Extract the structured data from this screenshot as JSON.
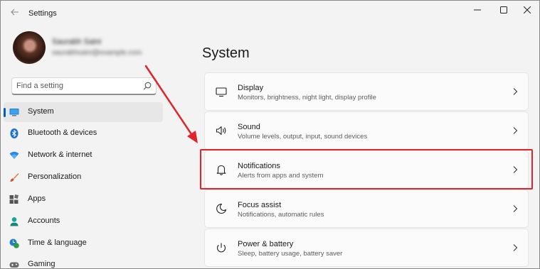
{
  "window": {
    "title": "Settings"
  },
  "user": {
    "name": "Saurabh Saini",
    "email": "saurabhsaini@example.com"
  },
  "search": {
    "placeholder": "Find a setting"
  },
  "nav": [
    {
      "label": "System",
      "icon": "system-icon",
      "selected": true
    },
    {
      "label": "Bluetooth & devices",
      "icon": "bluetooth-icon"
    },
    {
      "label": "Network & internet",
      "icon": "wifi-icon"
    },
    {
      "label": "Personalization",
      "icon": "brush-icon"
    },
    {
      "label": "Apps",
      "icon": "apps-icon"
    },
    {
      "label": "Accounts",
      "icon": "accounts-icon"
    },
    {
      "label": "Time & language",
      "icon": "time-language-icon"
    },
    {
      "label": "Gaming",
      "icon": "gaming-icon"
    }
  ],
  "main": {
    "title": "System",
    "cards": [
      {
        "title": "Display",
        "subtitle": "Monitors, brightness, night light, display profile",
        "icon": "display-icon"
      },
      {
        "title": "Sound",
        "subtitle": "Volume levels, output, input, sound devices",
        "icon": "speaker-icon"
      },
      {
        "title": "Notifications",
        "subtitle": "Alerts from apps and system",
        "icon": "bell-icon"
      },
      {
        "title": "Focus assist",
        "subtitle": "Notifications, automatic rules",
        "icon": "moon-icon"
      },
      {
        "title": "Power & battery",
        "subtitle": "Sleep, battery usage, battery saver",
        "icon": "power-icon"
      }
    ]
  },
  "colors": {
    "accent": "#005fb8",
    "annotation": "#e0242b",
    "background": "#f3f3f3",
    "card": "#fbfbfb"
  }
}
